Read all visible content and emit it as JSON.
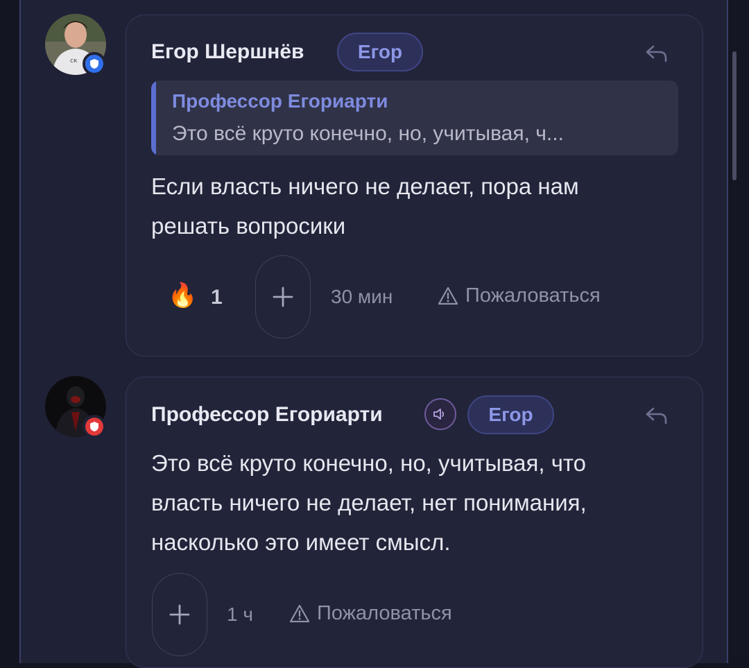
{
  "comments": [
    {
      "author": "Егор Шершнёв",
      "tag": "Егор",
      "avatar_icon": "user-photo",
      "badge_icon": "shield-icon",
      "badge_color": "#2f6fea",
      "quote": {
        "author": "Профессор Егориарти",
        "text": "Это всё круто конечно, но, учитывая, ч..."
      },
      "text_line1": "Если власть ничего не делает, пора нам",
      "text_line2": "решать вопросики",
      "reaction": {
        "emoji": "🔥",
        "count": "1"
      },
      "time": "30 мин",
      "report_label": "Пожаловаться"
    },
    {
      "author": "Профессор Егориарти",
      "tag": "Егор",
      "avatar_icon": "user-photo",
      "badge_icon": "shield-icon",
      "badge_color": "#e23a3a",
      "audio_icon": "speaker-icon",
      "text_line1": "Это всё круто конечно, но, учитывая, что",
      "text_line2": "власть ничего не делает, нет понимания,",
      "text_line3": "насколько это имеет смысл.",
      "time": "1 ч",
      "report_label": "Пожаловаться"
    }
  ],
  "colors": {
    "background": "#1f2136",
    "card": "#222439",
    "accent": "#5c6fd0",
    "tag_text": "#8d97e6"
  }
}
